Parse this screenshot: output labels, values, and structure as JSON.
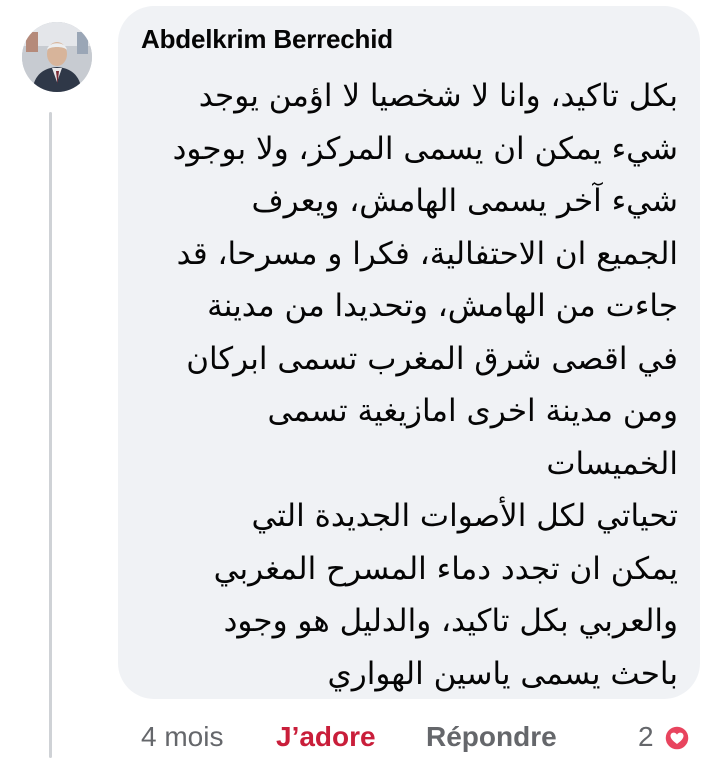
{
  "comment": {
    "author": "Abdelkrim Berrechid",
    "lines": [
      "بكل تاكيد، وانا لا شخصيا لا اؤمن يوجد",
      "شيء يمكن ان يسمى المركز،  ولا بوجود",
      "شيء آخر يسمى الهامش، ويعرف",
      "الجميع ان الاحتفالية، فكرا و مسرحا، قد",
      "جاءت من الهامش، وتحديدا من مدينة",
      "في اقصى شرق المغرب تسمى ابركان",
      "ومن مدينة اخرى امازيغية تسمى",
      "الخميسات",
      "تحياتي لكل الأصوات الجديدة التي",
      "يمكن ان تجدد دماء المسرح المغربي",
      "والعربي بكل تاكيد، والدليل هو وجود",
      "باحث يسمى ياسين الهواري"
    ]
  },
  "footer": {
    "time": "4 mois",
    "react_label": "J’adore",
    "reply_label": "Répondre",
    "reaction_count": "2",
    "reaction_icon": "heart-icon",
    "reaction_color": "#e8445e",
    "react_color": "#c91e3a"
  }
}
